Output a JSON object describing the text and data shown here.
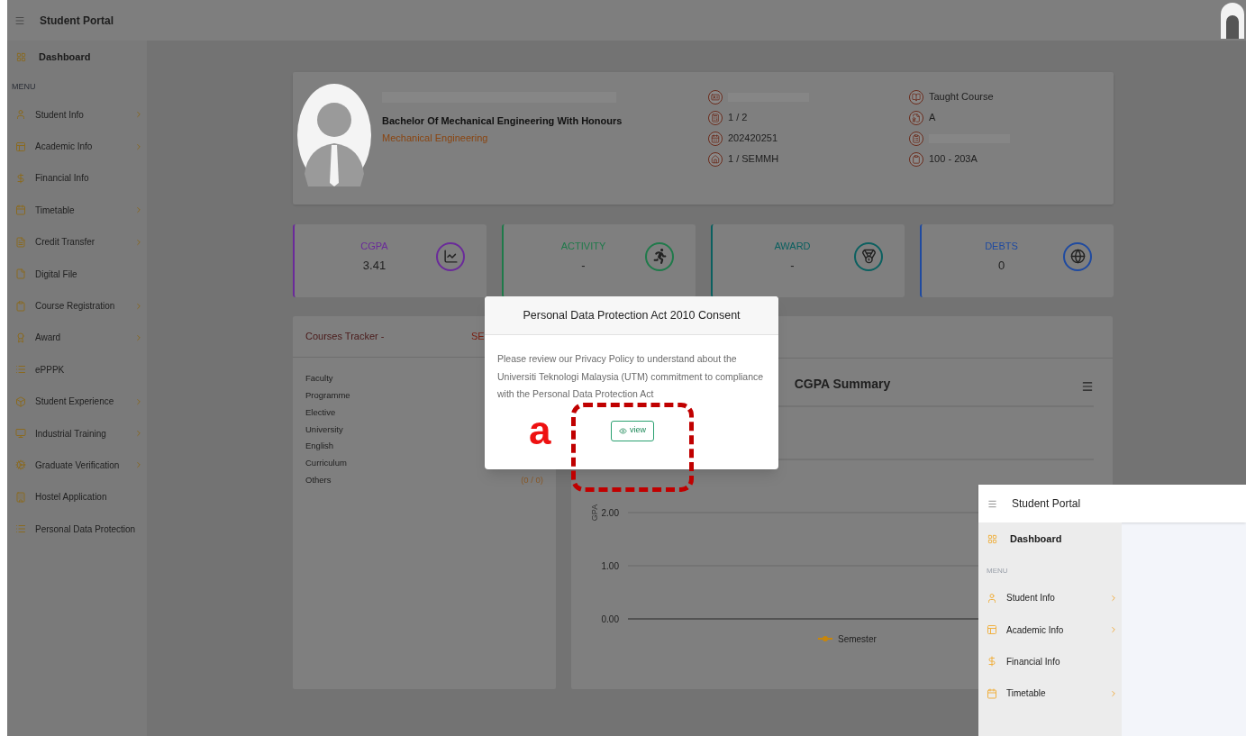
{
  "header": {
    "title": "Student Portal"
  },
  "sidebar": {
    "dashboard": "Dashboard",
    "section": "MENU",
    "items": [
      {
        "label": "Student Info",
        "has_submenu": true
      },
      {
        "label": "Academic Info",
        "has_submenu": true
      },
      {
        "label": "Financial Info",
        "has_submenu": false
      },
      {
        "label": "Timetable",
        "has_submenu": true
      },
      {
        "label": "Credit Transfer",
        "has_submenu": true
      },
      {
        "label": "Digital File",
        "has_submenu": false
      },
      {
        "label": "Course Registration",
        "has_submenu": true
      },
      {
        "label": "Award",
        "has_submenu": true
      },
      {
        "label": "ePPPK",
        "has_submenu": false
      },
      {
        "label": "Student Experience",
        "has_submenu": true
      },
      {
        "label": "Industrial Training",
        "has_submenu": true
      },
      {
        "label": "Graduate Verification",
        "has_submenu": true
      },
      {
        "label": "Hostel Application",
        "has_submenu": false
      },
      {
        "label": "Personal Data Protection",
        "has_submenu": false
      }
    ]
  },
  "profile": {
    "name_redacted": true,
    "programme": "Bachelor Of Mechanical Engineering With Honours",
    "faculty": "Mechanical Engineering",
    "column_1": [
      {
        "redacted": true
      },
      {
        "value": "1 / 2"
      },
      {
        "value": "202420251"
      },
      {
        "value": "1 / SEMMH"
      }
    ],
    "column_2": [
      {
        "value": "Taught Course"
      },
      {
        "value": "A"
      },
      {
        "redacted": true
      },
      {
        "value": "100 - 203A"
      }
    ]
  },
  "stats": [
    {
      "kind": "chart",
      "title": "CGPA",
      "value": "3.41",
      "color": "#6a2a9a"
    },
    {
      "kind": "runner",
      "title": "ACTIVITY",
      "value": "-",
      "color": "#1f7a4a"
    },
    {
      "kind": "medal",
      "title": "AWARD",
      "value": "-",
      "color": "#0b6060"
    },
    {
      "kind": "globe",
      "title": "DEBTS",
      "value": "0",
      "color": "#1f4aa0"
    }
  ],
  "courses_tracker": {
    "title": "Courses Tracker -",
    "column_2": "SE",
    "rows": [
      {
        "label": "Faculty"
      },
      {
        "label": "Programme"
      },
      {
        "label": "Elective"
      },
      {
        "label": "University"
      },
      {
        "label": "English"
      },
      {
        "label": "Curriculum"
      },
      {
        "label": "Others",
        "value": "(0 / 0)"
      }
    ]
  },
  "cgpa_chart": {
    "chart_data": {
      "type": "line",
      "title": "CGPA Summary",
      "ylabel": "GPA",
      "ylim": [
        0,
        4
      ],
      "yticks": [
        {
          "value": 0,
          "label": "0.00"
        },
        {
          "value": 1,
          "label": "1.00"
        },
        {
          "value": 2,
          "label": "2.00"
        }
      ],
      "series": [
        {
          "name": "Semester",
          "color": "#c8860a"
        }
      ]
    }
  },
  "modal": {
    "title": "Personal Data Protection Act 2010 Consent",
    "body": "Please review our Privacy Policy to understand about the Universiti Teknologi Malaysia (UTM) commitment to compliance with the Personal Data Protection Act",
    "button": "view"
  },
  "annotation": {
    "label": "a"
  },
  "inset": {
    "title": "Student Portal",
    "dashboard": "Dashboard",
    "section": "MENU",
    "items": [
      {
        "label": "Student Info",
        "has_submenu": true
      },
      {
        "label": "Academic Info",
        "has_submenu": true
      },
      {
        "label": "Financial Info",
        "has_submenu": false
      },
      {
        "label": "Timetable",
        "has_submenu": true
      }
    ]
  }
}
